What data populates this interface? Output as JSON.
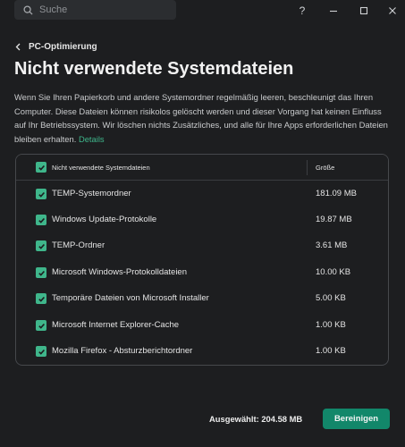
{
  "titlebar": {
    "search_placeholder": "Suche",
    "help_label": "?",
    "search_icon": "search-icon",
    "window_icons": [
      "help-icon",
      "minimize-icon",
      "maximize-icon",
      "close-icon"
    ]
  },
  "nav": {
    "back_label": "PC-Optimierung",
    "back_icon": "chevron-left-icon"
  },
  "page": {
    "title": "Nicht verwendete Systemdateien",
    "description": "Wenn Sie Ihren Papierkorb und andere Systemordner regelmäßig leeren, beschleunigt das Ihren Computer. Diese Dateien können risikolos gelöscht werden und dieser Vorgang hat keinen Einfluss auf Ihr Betriebssystem. Wir löschen nichts Zusätzliches, und alle für Ihre Apps erforderlichen Dateien bleiben erhalten.",
    "details_link": "Details"
  },
  "table": {
    "header": {
      "name": "Nicht verwendete Systemdateien",
      "size": "Größe",
      "checked": true
    },
    "rows": [
      {
        "name": "TEMP-Systemordner",
        "size": "181.09 MB",
        "checked": true
      },
      {
        "name": "Windows Update-Protokolle",
        "size": "19.87 MB",
        "checked": true
      },
      {
        "name": "TEMP-Ordner",
        "size": "3.61 MB",
        "checked": true
      },
      {
        "name": "Microsoft Windows-Protokolldateien",
        "size": "10.00 KB",
        "checked": true
      },
      {
        "name": "Temporäre Dateien von Microsoft Installer",
        "size": "5.00 KB",
        "checked": true
      },
      {
        "name": "Microsoft Internet Explorer-Cache",
        "size": "1.00 KB",
        "checked": true
      },
      {
        "name": "Mozilla Firefox - Absturzberichtordner",
        "size": "1.00 KB",
        "checked": true
      }
    ]
  },
  "footer": {
    "selected_label": "Ausgewählt: 204.58 MB",
    "clean_button": "Bereinigen"
  },
  "colors": {
    "accent": "#3fb68b",
    "button": "#12876a",
    "background": "#1d1e20"
  }
}
